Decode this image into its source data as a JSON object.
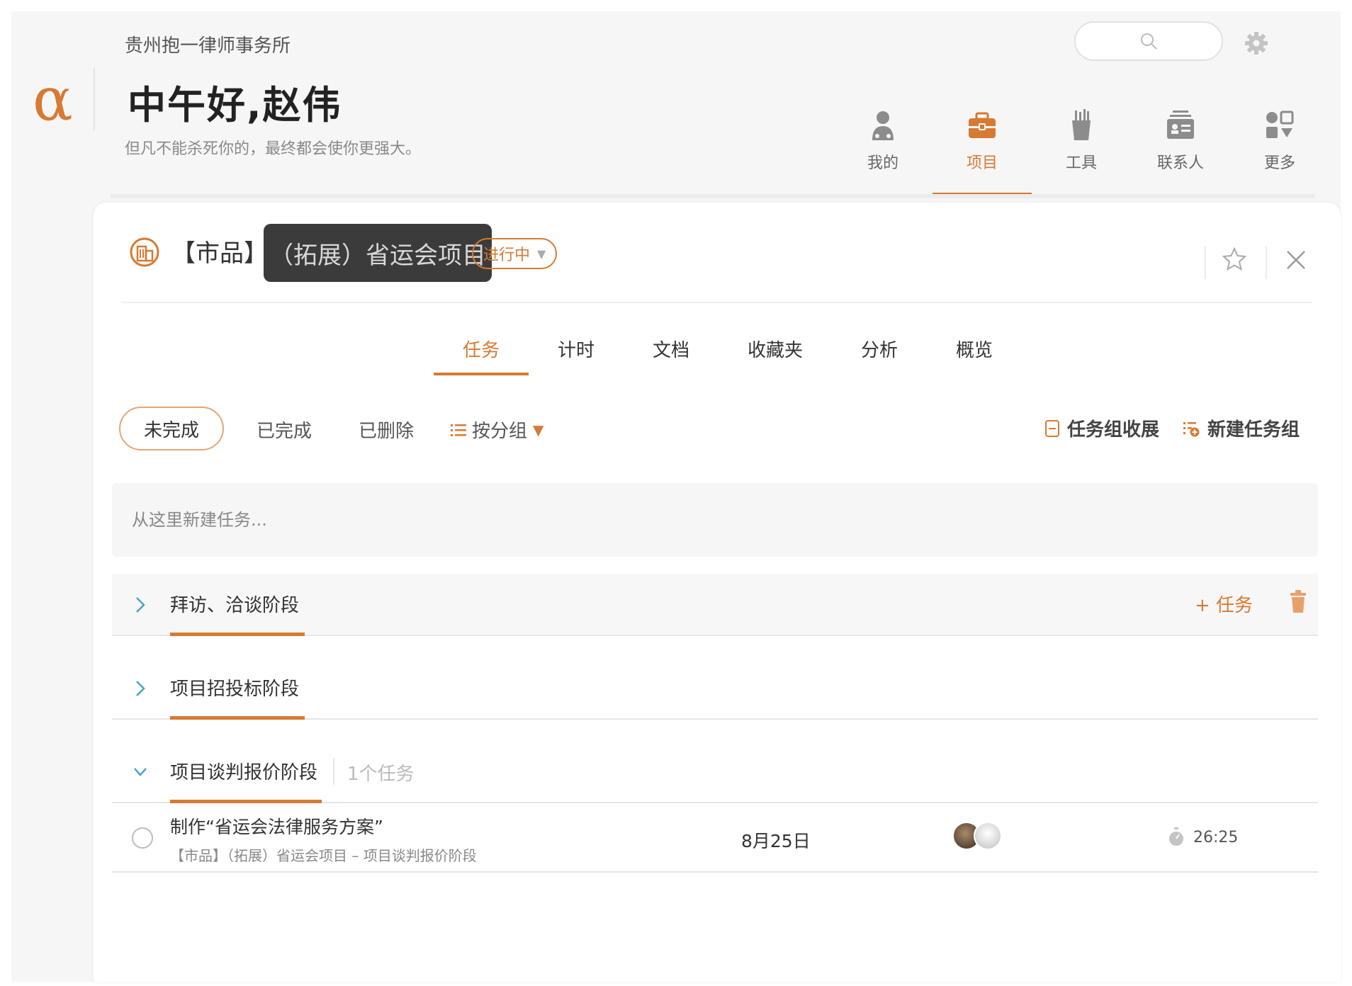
{
  "header": {
    "firm_name": "贵州抱一律师事务所",
    "greeting": "中午好,赵伟",
    "motto": "但凡不能杀死你的，最终都会使你更强大。",
    "logo_text": "α"
  },
  "topnav": [
    {
      "label": "我的",
      "icon": "person-icon"
    },
    {
      "label": "项目",
      "icon": "briefcase-icon",
      "active": true
    },
    {
      "label": "工具",
      "icon": "tools-cup-icon"
    },
    {
      "label": "联系人",
      "icon": "contact-card-icon"
    },
    {
      "label": "更多",
      "icon": "more-grid-icon"
    }
  ],
  "project": {
    "title_prefix": "【市品】",
    "title_highlight": "（拓展）省运会项目",
    "status": "进行中"
  },
  "subtabs": [
    {
      "label": "任务",
      "active": true
    },
    {
      "label": "计时"
    },
    {
      "label": "文档"
    },
    {
      "label": "收藏夹"
    },
    {
      "label": "分析"
    },
    {
      "label": "概览"
    }
  ],
  "filters": {
    "incomplete": "未完成",
    "completed": "已完成",
    "deleted": "已删除",
    "group_by": "按分组",
    "collapse_groups": "任务组收展",
    "new_group": "新建任务组"
  },
  "new_task_placeholder": "从这里新建任务...",
  "groups": [
    {
      "name": "拜访、洽谈阶段",
      "expanded": false,
      "add_task_label": "+ 任务"
    },
    {
      "name": "项目招投标阶段",
      "expanded": false
    },
    {
      "name": "项目谈判报价阶段",
      "expanded": true,
      "count_label": "1个任务"
    }
  ],
  "tasks": [
    {
      "title": "制作“省运会法律服务方案”",
      "subtitle": "【市品】（拓展）省运会项目 – 项目谈判报价阶段",
      "date": "8月25日",
      "time": "26:25"
    }
  ],
  "colors": {
    "accent": "#d77a33",
    "chevron": "#4aa3c8"
  }
}
